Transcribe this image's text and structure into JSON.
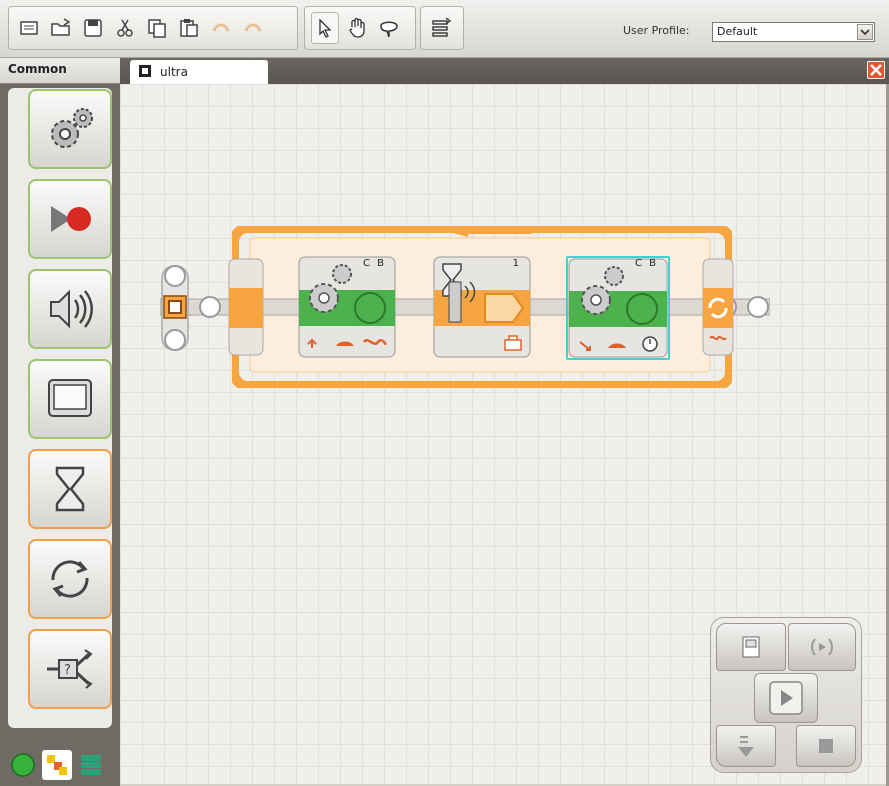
{
  "toolbar": {
    "buttons": [
      "new-file",
      "open-file",
      "save",
      "cut",
      "copy",
      "paste",
      "undo",
      "redo",
      "pointer",
      "pan",
      "comment",
      "sequence"
    ],
    "profile_label": "User Profile:",
    "profile_value": "Default"
  },
  "palette": {
    "title": "Common",
    "items": [
      "move-block",
      "record-play-block",
      "sound-block",
      "display-block",
      "wait-block",
      "loop-block",
      "switch-block"
    ]
  },
  "tab": {
    "label": "ultra"
  },
  "program": {
    "move1_ports": "C B",
    "sensor_port": "1",
    "move2_ports": "C B"
  },
  "colors": {
    "accent": "#f7a540",
    "green": "#4db24d",
    "selection": "#3fd0d0"
  }
}
